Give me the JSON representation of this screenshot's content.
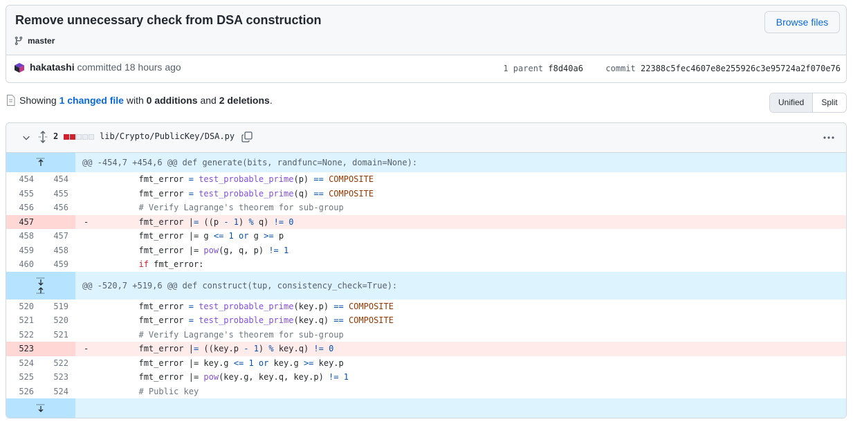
{
  "commit": {
    "title": "Remove unnecessary check from DSA construction",
    "branch": "master",
    "browse_label": "Browse files",
    "author": "hakatashi",
    "committed_text": "committed 18 hours ago",
    "parent_label": "1 parent",
    "parent_sha": "f8d40a6",
    "commit_label": "commit",
    "commit_sha": "22388c5fec4607e8e255926c3e95724a2f070e76"
  },
  "summary": {
    "prefix": "Showing",
    "changed": "1 changed file",
    "mid1": "with",
    "additions": "0 additions",
    "mid2": "and",
    "deletions": "2 deletions",
    "suffix": "."
  },
  "view_toggle": {
    "unified": "Unified",
    "split": "Split"
  },
  "file": {
    "count": "2",
    "path": "lib/Crypto/PublicKey/DSA.py",
    "diffstat": [
      "del",
      "del",
      "neutral",
      "neutral",
      "neutral"
    ]
  },
  "hunks": [
    {
      "header": "@@ -454,7 +454,6 @@ def generate(bits, randfunc=None, domain=None):",
      "lines": [
        {
          "old": "454",
          "new": "454",
          "type": "ctx"
        },
        {
          "old": "455",
          "new": "455",
          "type": "ctx"
        },
        {
          "old": "456",
          "new": "456",
          "type": "ctx"
        },
        {
          "old": "457",
          "new": "",
          "type": "del",
          "marker": "-"
        },
        {
          "old": "458",
          "new": "457",
          "type": "ctx"
        },
        {
          "old": "459",
          "new": "458",
          "type": "ctx"
        },
        {
          "old": "460",
          "new": "459",
          "type": "ctx"
        }
      ]
    },
    {
      "header": "@@ -520,7 +519,6 @@ def construct(tup, consistency_check=True):",
      "lines": [
        {
          "old": "520",
          "new": "519",
          "type": "ctx"
        },
        {
          "old": "521",
          "new": "520",
          "type": "ctx"
        },
        {
          "old": "522",
          "new": "521",
          "type": "ctx"
        },
        {
          "old": "523",
          "new": "",
          "type": "del",
          "marker": "-"
        },
        {
          "old": "524",
          "new": "522",
          "type": "ctx"
        },
        {
          "old": "525",
          "new": "523",
          "type": "ctx"
        },
        {
          "old": "526",
          "new": "524",
          "type": "ctx"
        }
      ]
    }
  ],
  "code": {
    "h0": [
      "fmt_error = test_probable_prime(p) == COMPOSITE",
      "fmt_error = test_probable_prime(q) == COMPOSITE",
      "# Verify Lagrange's theorem for sub-group",
      "fmt_error |= ((p - 1) % q) != 0",
      "fmt_error |= g <= 1 or g >= p",
      "fmt_error |= pow(g, q, p) != 1",
      "if fmt_error:"
    ],
    "h1": [
      "fmt_error = test_probable_prime(key.p) == COMPOSITE",
      "fmt_error = test_probable_prime(key.q) == COMPOSITE",
      "# Verify Lagrange's theorem for sub-group",
      "fmt_error |= ((key.p - 1) % key.q) != 0",
      "fmt_error |= key.g <= 1 or key.g >= key.p",
      "fmt_error |= pow(key.g, key.q, key.p) != 1",
      "# Public key"
    ]
  },
  "colors": {
    "accent": "#0969da",
    "deletion": "#cf222e",
    "hunk_bg": "#ddf4ff"
  }
}
